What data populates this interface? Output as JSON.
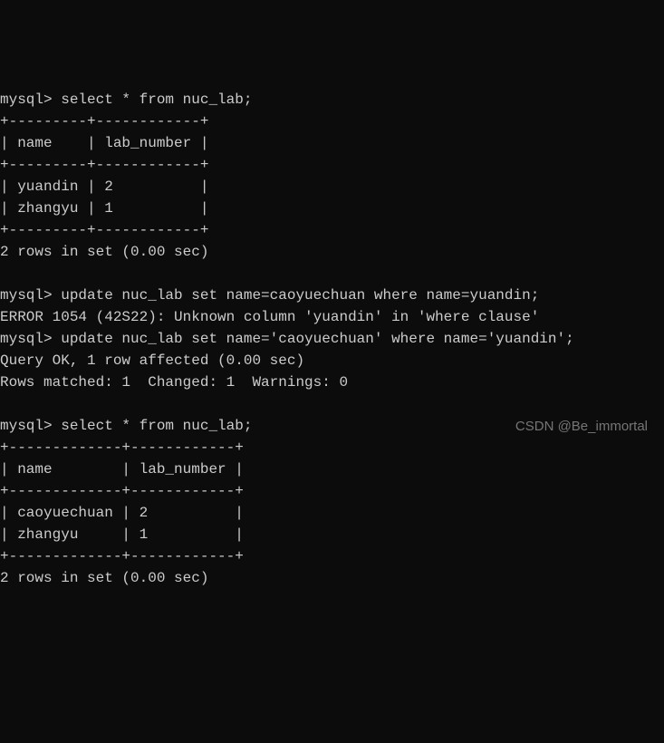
{
  "terminal": {
    "line01": "mysql> select * from nuc_lab;",
    "line02": "+---------+------------+",
    "line03": "| name    | lab_number |",
    "line04": "+---------+------------+",
    "line05": "| yuandin | 2          |",
    "line06": "| zhangyu | 1          |",
    "line07": "+---------+------------+",
    "line08": "2 rows in set (0.00 sec)",
    "line09": "",
    "line10": "mysql> update nuc_lab set name=caoyuechuan where name=yuandin;",
    "line11": "ERROR 1054 (42S22): Unknown column 'yuandin' in 'where clause'",
    "line12": "mysql> update nuc_lab set name='caoyuechuan' where name='yuandin';",
    "line13": "Query OK, 1 row affected (0.00 sec)",
    "line14": "Rows matched: 1  Changed: 1  Warnings: 0",
    "line15": "",
    "line16": "mysql> select * from nuc_lab;",
    "line17": "+-------------+------------+",
    "line18": "| name        | lab_number |",
    "line19": "+-------------+------------+",
    "line20": "| caoyuechuan | 2          |",
    "line21": "| zhangyu     | 1          |",
    "line22": "+-------------+------------+",
    "line23": "2 rows in set (0.00 sec)"
  },
  "watermark": {
    "text": "CSDN @Be_immortal"
  },
  "chart_data": {
    "type": "table",
    "tables": [
      {
        "query": "select * from nuc_lab;",
        "columns": [
          "name",
          "lab_number"
        ],
        "rows": [
          {
            "name": "yuandin",
            "lab_number": 2
          },
          {
            "name": "zhangyu",
            "lab_number": 1
          }
        ],
        "summary": "2 rows in set (0.00 sec)"
      },
      {
        "query": "select * from nuc_lab;",
        "columns": [
          "name",
          "lab_number"
        ],
        "rows": [
          {
            "name": "caoyuechuan",
            "lab_number": 2
          },
          {
            "name": "zhangyu",
            "lab_number": 1
          }
        ],
        "summary": "2 rows in set (0.00 sec)"
      }
    ],
    "commands": [
      {
        "text": "update nuc_lab set name=caoyuechuan where name=yuandin;",
        "result": "ERROR 1054 (42S22): Unknown column 'yuandin' in 'where clause'"
      },
      {
        "text": "update nuc_lab set name='caoyuechuan' where name='yuandin';",
        "result": "Query OK, 1 row affected (0.00 sec)",
        "detail": "Rows matched: 1  Changed: 1  Warnings: 0"
      }
    ]
  }
}
